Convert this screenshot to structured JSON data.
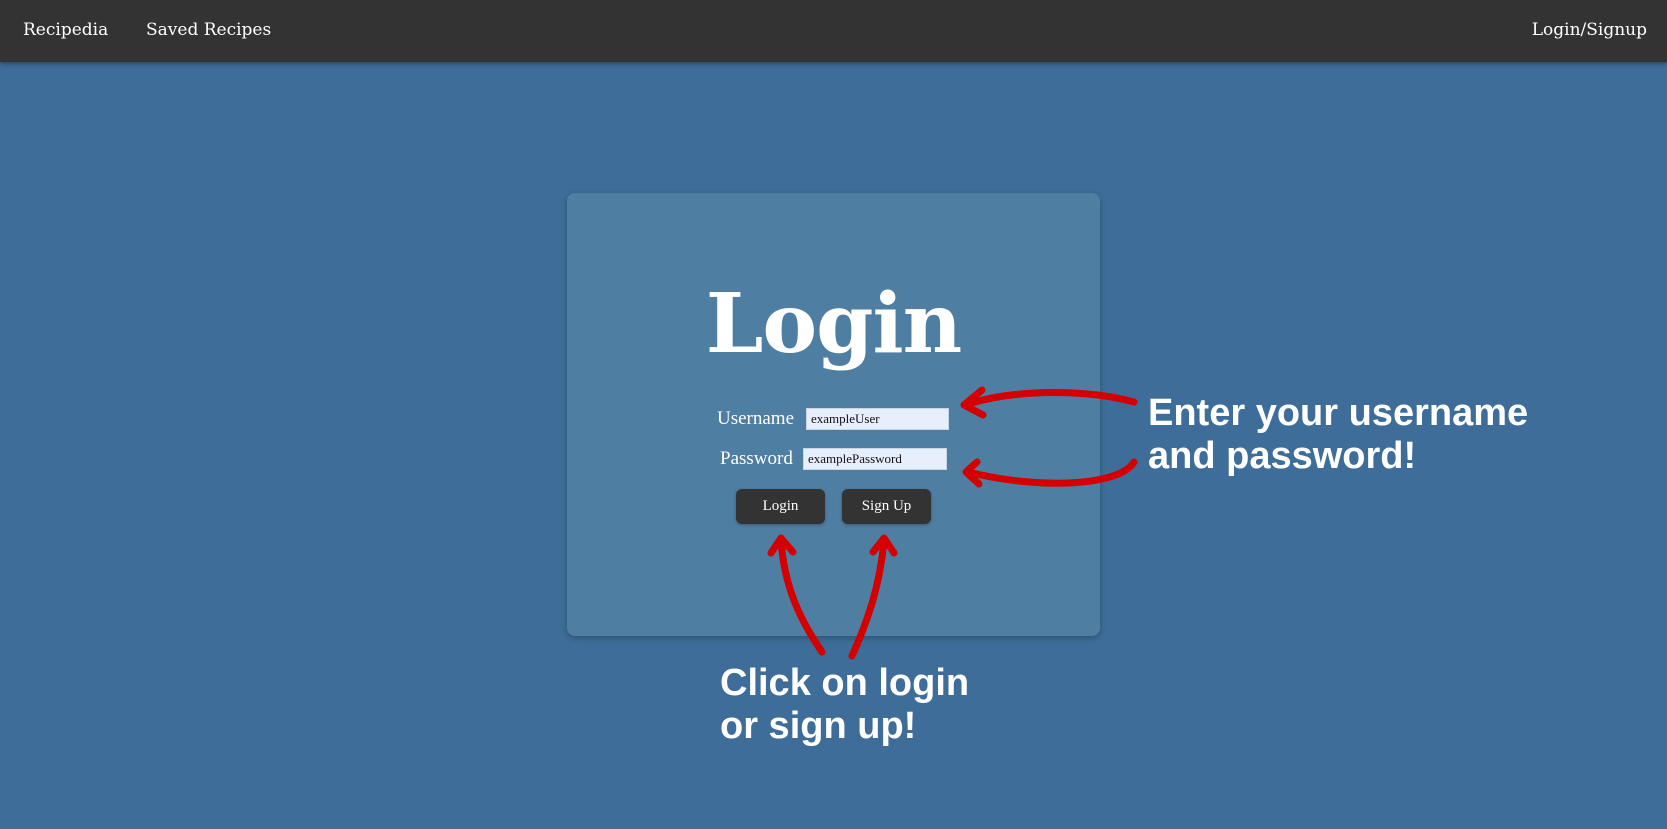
{
  "nav": {
    "brand": "Recipedia",
    "saved": "Saved Recipes",
    "login_signup": "Login/Signup"
  },
  "login_card": {
    "title": "Login",
    "username_label": "Username",
    "username_value": "exampleUser",
    "password_label": "Password",
    "password_value": "examplePassword",
    "login_button": "Login",
    "signup_button": "Sign Up"
  },
  "annotations": {
    "fields_line1": "Enter your username",
    "fields_line2": "and password!",
    "buttons_line1": "Click on login",
    "buttons_line2": "or sign up!"
  },
  "colors": {
    "background": "#3d6d98",
    "navbar": "#333333",
    "card": "#4f7ea3",
    "annotation_arrow": "#d40000"
  },
  "icons": {
    "arrow": "hand-drawn-arrow-icon"
  }
}
